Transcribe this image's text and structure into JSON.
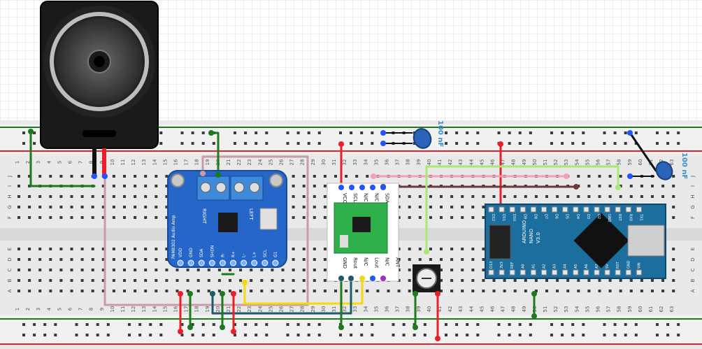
{
  "columns": [
    "1",
    "2",
    "3",
    "4",
    "5",
    "6",
    "7",
    "8",
    "9",
    "10",
    "11",
    "12",
    "13",
    "14",
    "15",
    "16",
    "17",
    "18",
    "19",
    "20",
    "21",
    "22",
    "23",
    "24",
    "25",
    "26",
    "27",
    "28",
    "29",
    "30",
    "31",
    "32",
    "33",
    "34",
    "35",
    "36",
    "37",
    "38",
    "39",
    "40",
    "41",
    "42",
    "43",
    "44",
    "45",
    "46",
    "47",
    "48",
    "49",
    "50",
    "51",
    "52",
    "53",
    "54",
    "55",
    "56",
    "57",
    "58",
    "59",
    "60",
    "61",
    "62",
    "63"
  ],
  "rows_top": [
    "J",
    "I",
    "H",
    "G",
    "F"
  ],
  "rows_bottom": [
    "E",
    "D",
    "C",
    "B",
    "A"
  ],
  "amplifier": {
    "title": "PAM8302 Audio Amp",
    "right_label": "RIGHT",
    "left_label": "LEFT",
    "pins": [
      "VDD",
      "GND",
      "SDA",
      "SHDN",
      "R-",
      "R+",
      "L-",
      "L+",
      "SCL",
      "G1"
    ]
  },
  "radio": {
    "top_pins": [
      "VCC",
      "SCL",
      "N/C",
      "N/C",
      "SDA"
    ],
    "bottom_pins": [
      "GND",
      "Rout",
      "N/C",
      "Lout",
      "N/C",
      "ANT"
    ]
  },
  "arduino": {
    "name": "ARDUINO",
    "model": "NANO",
    "version": "V3.0",
    "top_pins": [
      "D12",
      "D11",
      "D10",
      "D9",
      "D8",
      "D7",
      "D6",
      "D5",
      "D4",
      "D3",
      "D2",
      "GND",
      "RST",
      "RX0",
      "TX1"
    ],
    "bottom_pins": [
      "D13",
      "3V3",
      "REF",
      "A0",
      "A1",
      "A2",
      "A3",
      "A4",
      "A5",
      "A6",
      "A7",
      "5V",
      "RST",
      "GND",
      "VIN"
    ]
  },
  "capacitor_1": {
    "label": "100 nF"
  },
  "capacitor_2": {
    "label": "100 nF"
  },
  "colors": {
    "wire_red": "#e8202a",
    "wire_green": "#1d7a1d",
    "wire_pink": "#c99aa8",
    "wire_pink_bright": "#f5a0b5",
    "wire_brown": "#6a3b3b",
    "wire_yellow": "#f5d90f",
    "wire_teal": "#1e5a68",
    "wire_lime": "#a8e878",
    "wire_black": "#111111",
    "amp_board": "#2666c9",
    "nano_board": "#1c6e9e",
    "radio_board": "#2fb04a"
  }
}
